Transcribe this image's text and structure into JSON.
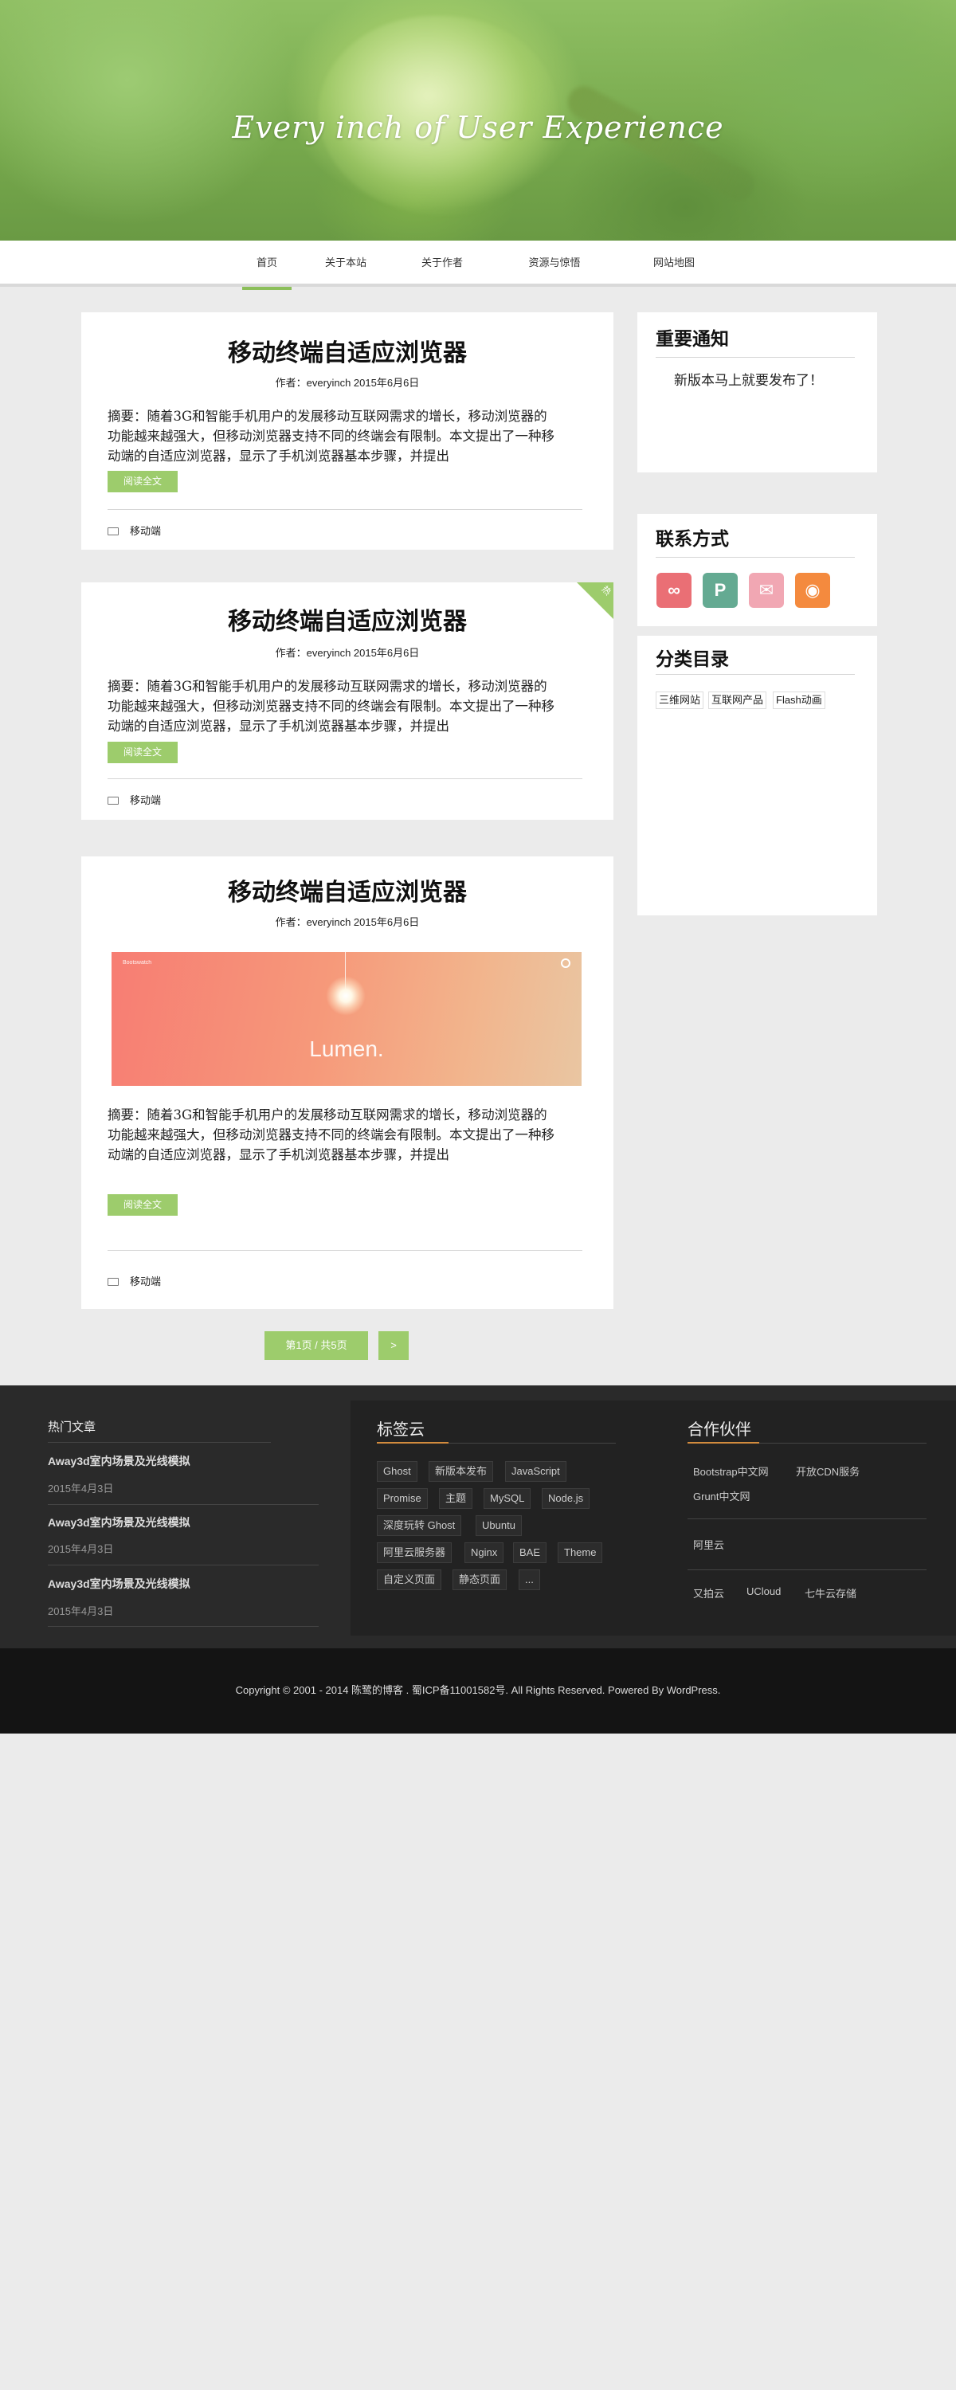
{
  "header": {
    "title": "Every inch of User Experience"
  },
  "nav": {
    "items": [
      {
        "label": "首页"
      },
      {
        "label": "关于本站"
      },
      {
        "label": "关于作者"
      },
      {
        "label": "资源与惊悟"
      },
      {
        "label": "网站地图"
      }
    ]
  },
  "posts": [
    {
      "title": "移动终端自适应浏览器",
      "meta": "作者：everyinch 2015年6月6日",
      "summary": "摘要：随着3G和智能手机用户的发展移动互联网需求的增长，移动浏览器的功能越来越强大，但移动浏览器支持不同的终端会有限制。本文提出了一种移动端的自适应浏览器，显示了手机浏览器基本步骤，并提出",
      "read_more": "阅读全文",
      "category": "移动端"
    },
    {
      "title": "移动终端自适应浏览器",
      "meta": "作者：everyinch 2015年6月6日",
      "corner_badge": "热",
      "summary": "摘要：随着3G和智能手机用户的发展移动互联网需求的增长，移动浏览器的功能越来越强大，但移动浏览器支持不同的终端会有限制。本文提出了一种移动端的自适应浏览器，显示了手机浏览器基本步骤，并提出",
      "read_more": "阅读全文",
      "category": "移动端"
    },
    {
      "title": "移动终端自适应浏览器",
      "meta": "作者：everyinch 2015年6月6日",
      "image": {
        "small_text": "Bootswatch",
        "logo_text": "Lumen."
      },
      "summary": "摘要：随着3G和智能手机用户的发展移动互联网需求的增长，移动浏览器的功能越来越强大，但移动浏览器支持不同的终端会有限制。本文提出了一种移动端的自适应浏览器，显示了手机浏览器基本步骤，并提出",
      "read_more": "阅读全文",
      "category": "移动端"
    }
  ],
  "pagination": {
    "status": "第1页 / 共5页",
    "next": ">"
  },
  "sidebar": {
    "notice": {
      "title": "重要通知",
      "text": "新版本马上就要发布了！"
    },
    "contact": {
      "title": "联系方式",
      "items": [
        {
          "icon": "weibo-icon",
          "color": "#ea6f75",
          "glyph": "∞"
        },
        {
          "icon": "pinterest-icon",
          "color": "#64aa92",
          "glyph": "P"
        },
        {
          "icon": "mail-icon",
          "color": "#f1a7b3",
          "glyph": "✉"
        },
        {
          "icon": "rss-icon",
          "color": "#f48a3e",
          "glyph": "◉"
        }
      ]
    },
    "categories": {
      "title": "分类目录",
      "items": [
        "三维网站",
        "互联网产品",
        "Flash动画"
      ]
    }
  },
  "footer": {
    "hot": {
      "title": "热门文章",
      "items": [
        {
          "title": "Away3d室内场景及光线模拟",
          "date": "2015年4月3日"
        },
        {
          "title": "Away3d室内场景及光线模拟",
          "date": "2015年4月3日"
        },
        {
          "title": "Away3d室内场景及光线模拟",
          "date": "2015年4月3日"
        }
      ]
    },
    "tags": {
      "title": "标签云",
      "items": [
        "Ghost",
        "新版本发布",
        "JavaScript",
        "Promise",
        "主题",
        "MySQL",
        "Node.js",
        "深度玩转 Ghost",
        "Ubuntu",
        "阿里云服务器",
        "Nginx",
        "BAE",
        "Theme",
        "自定义页面",
        "静态页面",
        "..."
      ]
    },
    "partners": {
      "title": "合作伙伴",
      "items": [
        "Bootstrap中文网",
        "开放CDN服务",
        "Grunt中文网",
        "阿里云",
        "又拍云",
        "UCloud",
        "七牛云存储"
      ]
    },
    "copyright": "Copyright © 2001 - 2014 陈鹭的博客 . 蜀ICP备11001582号. All Rights Reserved. Powered By WordPress."
  },
  "colors": {
    "accent": "#9dcc6c",
    "footer_accent": "#d28b3d"
  }
}
